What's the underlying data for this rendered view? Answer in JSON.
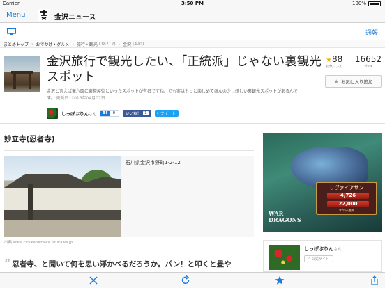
{
  "status_bar": {
    "carrier": "Carrier",
    "time": "3:50 PM",
    "battery": "100%"
  },
  "nav": {
    "menu_label": "Menu",
    "site_title": "金沢ニュース"
  },
  "toolrow": {
    "notify_label": "通報"
  },
  "breadcrumb": [
    {
      "label": "まとめトップ",
      "count": ""
    },
    {
      "label": "おでかけ・グルメ",
      "count": ""
    },
    {
      "label": "旅行・観光",
      "count": "(18712)"
    },
    {
      "label": "金沢",
      "count": "(420)"
    }
  ],
  "article": {
    "title": "金沢旅行で観光したい、「正統派」じゃない裏観光スポット",
    "description": "金沢と言えば兼六園に東茶屋街といったスポットが有名ですね。でも実はもっと楽しめてほんの少し妖しい裏観光スポットがあるんです。",
    "updated": "更新日: 2016年04月07日",
    "author": {
      "name": "しっぽぷりん",
      "suffix": "さん"
    },
    "hatena": {
      "label": "B!",
      "count": "0"
    },
    "facebook": {
      "label": "いいね！",
      "count": "1"
    },
    "twitter": {
      "label": "ツイート"
    }
  },
  "stats": {
    "favorites": {
      "value": "88",
      "label": "お気に入り"
    },
    "views": {
      "value": "16652",
      "label": "view"
    }
  },
  "favorite_button": {
    "label": "お気に入り追加"
  },
  "section": {
    "title": "妙立寺(忍者寺)",
    "address": "石川県金沢市野町1-2-12",
    "credit": "出典 www.city.kanazawa.ishikawa.jp",
    "body": "忍者寺、と聞いて何を思い浮かべるだろうか。パン！と叩くと畳や"
  },
  "ad": {
    "name": "リヴァイアサン",
    "hp": "4,726",
    "atk": "22,000",
    "sub": "水の守護神",
    "logo_line1": "WAR",
    "logo_line2": "DRAGONS"
  },
  "author_card": {
    "name": "しっぽぷりん",
    "suffix": "さん",
    "tag": "公式サイト"
  },
  "toolbar_icons": [
    "close-icon",
    "reload-icon",
    "star-icon",
    "share-icon"
  ],
  "colors": {
    "accent": "#1a7cd8",
    "star": "#f0b400"
  }
}
